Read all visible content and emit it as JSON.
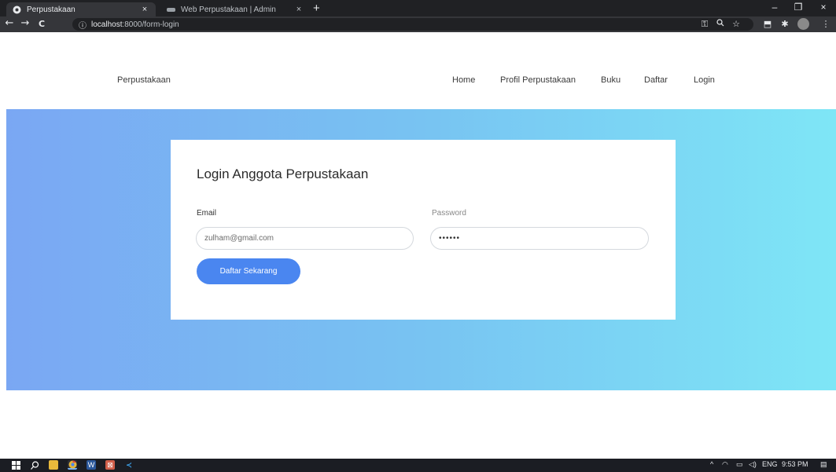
{
  "browser": {
    "tabs": [
      {
        "title": "Perpustakaan",
        "icon": "globe-icon",
        "close": "×"
      },
      {
        "title": "Web Perpustakaan | Admin",
        "icon": "web-icon",
        "close": "×"
      }
    ],
    "new_tab": "+",
    "window_controls": {
      "minimize": "–",
      "restore": "❐",
      "close": "×"
    },
    "nav": {
      "back": "←",
      "forward": "→",
      "reload": "C"
    },
    "url": {
      "info": "ⓘ",
      "host": "localhost",
      "path": ":8000/form-login"
    },
    "url_icons": {
      "key": "⚿",
      "zoom": "🔍",
      "star": "☆"
    },
    "ext_icons": {
      "extension": "⬒",
      "puzzle": "✱",
      "menu": "⋮"
    }
  },
  "site": {
    "brand": "Perpustakaan",
    "menu": [
      "Home",
      "Profil Perpustakaan",
      "Buku",
      "Daftar",
      "Login"
    ]
  },
  "login_form": {
    "title": "Login Anggota Perpustakaan",
    "email_label": "Email",
    "email_value": "zulham@gmail.com",
    "password_label": "Password",
    "password_value": "••••••",
    "submit_label": "Daftar Sekarang"
  },
  "taskbar": {
    "apps": [
      "windows-start-icon",
      "search-icon",
      "file-explorer-icon",
      "chrome-icon",
      "word-icon",
      "app-icon",
      "vscode-icon"
    ],
    "tray": {
      "chevron": "^",
      "language": "ENG",
      "time": "9:53 PM"
    }
  },
  "colors": {
    "accent": "#4a86f0",
    "gradient_start": "#7aa7f3",
    "gradient_end": "#7ee6f6"
  }
}
